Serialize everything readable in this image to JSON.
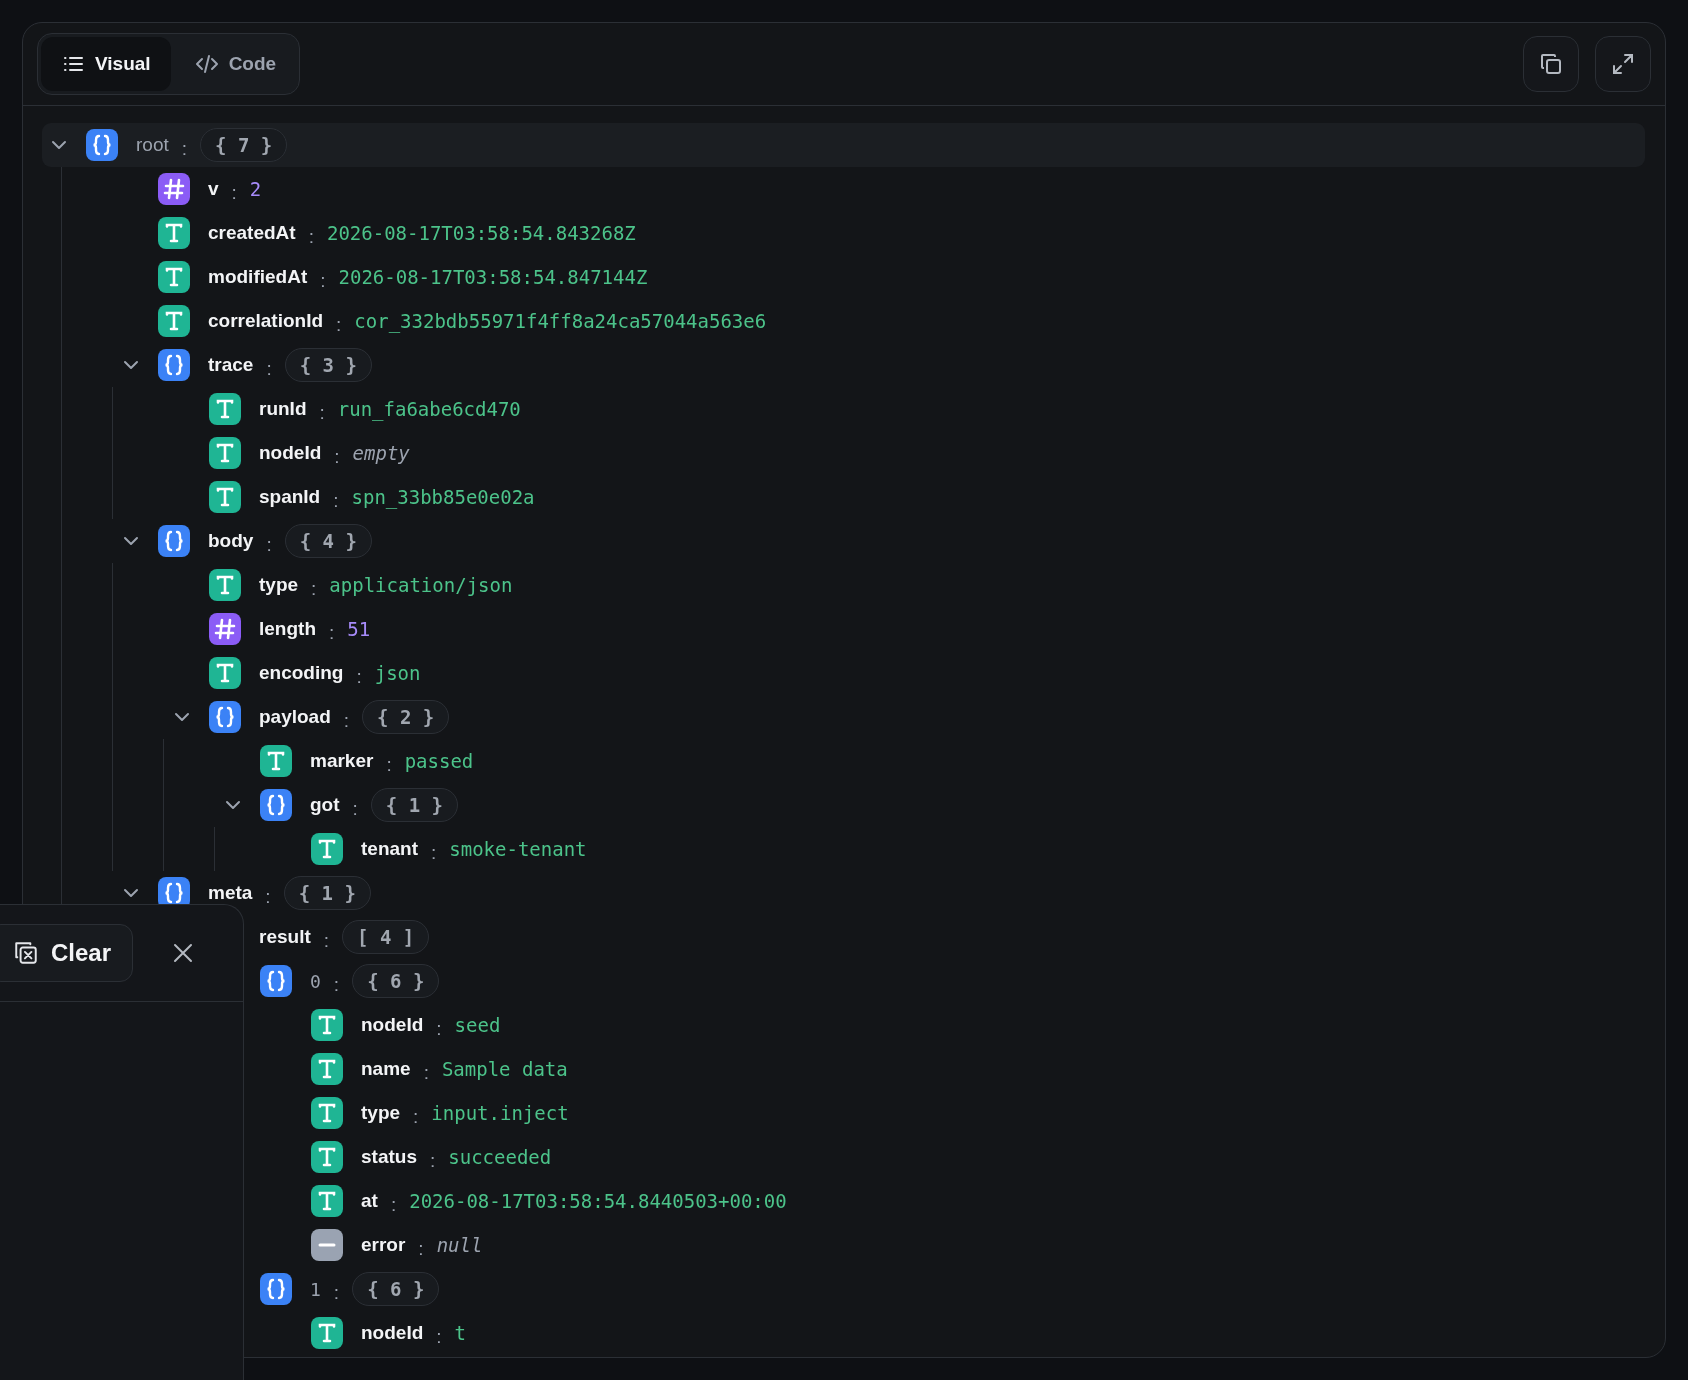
{
  "toolbar": {
    "tabs": [
      {
        "label": "Visual",
        "selected": true
      },
      {
        "label": "Code",
        "selected": false
      }
    ],
    "actions": [
      {
        "kind": "copy"
      },
      {
        "kind": "expand"
      }
    ]
  },
  "tree": {
    "key": "root",
    "sep": ":",
    "kind": "object",
    "badge": "{ 7 }",
    "expanded": true,
    "children": [
      {
        "key": "v",
        "sep": ":",
        "kind": "number",
        "value": "2"
      },
      {
        "key": "createdAt",
        "sep": ":",
        "kind": "string",
        "value": "2026-08-17T03:58:54.843268Z"
      },
      {
        "key": "modifiedAt",
        "sep": ":",
        "kind": "string",
        "value": "2026-08-17T03:58:54.847144Z"
      },
      {
        "key": "correlationId",
        "sep": ":",
        "kind": "string",
        "value": "cor_332bdb55971f4ff8a24ca57044a563e6"
      },
      {
        "key": "trace",
        "sep": ":",
        "kind": "object",
        "badge": "{ 3 }",
        "expanded": true,
        "children": [
          {
            "key": "runId",
            "sep": ":",
            "kind": "string",
            "value": "run_fa6abe6cd470"
          },
          {
            "key": "nodeId",
            "sep": ":",
            "kind": "empty",
            "value": "empty"
          },
          {
            "key": "spanId",
            "sep": ":",
            "kind": "string",
            "value": "spn_33bb85e0e02a"
          }
        ]
      },
      {
        "key": "body",
        "sep": ":",
        "kind": "object",
        "badge": "{ 4 }",
        "expanded": true,
        "children": [
          {
            "key": "type",
            "sep": ":",
            "kind": "string",
            "value": "application/json"
          },
          {
            "key": "length",
            "sep": ":",
            "kind": "number",
            "value": "51"
          },
          {
            "key": "encoding",
            "sep": ":",
            "kind": "string",
            "value": "json"
          },
          {
            "key": "payload",
            "sep": ":",
            "kind": "object",
            "badge": "{ 2 }",
            "expanded": true,
            "children": [
              {
                "key": "marker",
                "sep": ":",
                "kind": "string",
                "value": "passed"
              },
              {
                "key": "got",
                "sep": ":",
                "kind": "object",
                "badge": "{ 1 }",
                "expanded": true,
                "children": [
                  {
                    "key": "tenant",
                    "sep": ":",
                    "kind": "string",
                    "value": "smoke-tenant"
                  }
                ]
              }
            ]
          }
        ]
      },
      {
        "key": "meta",
        "sep": ":",
        "kind": "object",
        "badge": "{ 1 }",
        "expanded": true,
        "children": [
          {
            "key": "result",
            "sep": ":",
            "kind": "array",
            "badge": "[ 4 ]",
            "children": [
              {
                "key": "0",
                "sep": ":",
                "kind": "object",
                "badge": "{ 6 }",
                "children": [
                  {
                    "key": "nodeId",
                    "sep": ":",
                    "kind": "string",
                    "value": "seed"
                  },
                  {
                    "key": "name",
                    "sep": ":",
                    "kind": "string",
                    "value": "Sample data"
                  },
                  {
                    "key": "type",
                    "sep": ":",
                    "kind": "string",
                    "value": "input.inject"
                  },
                  {
                    "key": "status",
                    "sep": ":",
                    "kind": "string",
                    "value": "succeeded"
                  },
                  {
                    "key": "at",
                    "sep": ":",
                    "kind": "string",
                    "value": "2026-08-17T03:58:54.8440503+00:00"
                  },
                  {
                    "key": "error",
                    "sep": ":",
                    "kind": "null",
                    "value": "null"
                  }
                ]
              },
              {
                "key": "1",
                "sep": ":",
                "kind": "object",
                "badge": "{ 6 }",
                "children": [
                  {
                    "key": "nodeId",
                    "sep": ":",
                    "kind": "string",
                    "value": "t"
                  }
                ]
              }
            ]
          }
        ]
      }
    ]
  },
  "panel": {
    "clear_label": "Clear"
  }
}
